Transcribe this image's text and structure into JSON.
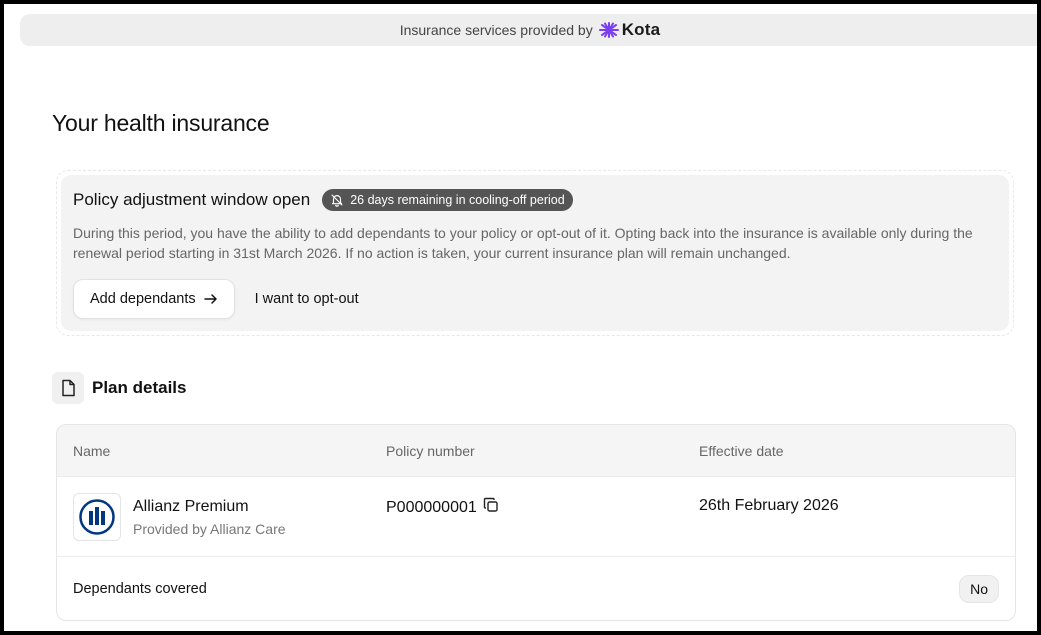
{
  "banner": {
    "text": "Insurance services provided by",
    "brand": "Kota",
    "brand_color": "#7b3ff2"
  },
  "page": {
    "title": "Your health insurance"
  },
  "policy_window": {
    "title": "Policy adjustment window open",
    "badge_icon": "bell-icon",
    "badge": "26 days remaining in cooling-off period",
    "description": "During this period, you have the ability to add dependants to your policy or opt-out of it. Opting back into the insurance is available only during the renewal period starting in 31st March 2026. If no action is taken, your current insurance plan will remain unchanged.",
    "add_button": "Add dependants",
    "add_button_icon": "arrow-right-icon",
    "optout_button": "I want to opt-out"
  },
  "plan": {
    "title": "Plan details",
    "icon": "document-icon",
    "columns": [
      "Name",
      "Policy number",
      "Effective date"
    ],
    "row": {
      "insurer_name": "Allianz Premium",
      "insurer_sub": "Provided by Allianz Care",
      "insurer_color": "#003781",
      "policy_number": "P000000001",
      "copy_icon": "copy-icon",
      "effective_date": "26th February 2026"
    },
    "dependants_label": "Dependants covered",
    "dependants_value": "No"
  }
}
